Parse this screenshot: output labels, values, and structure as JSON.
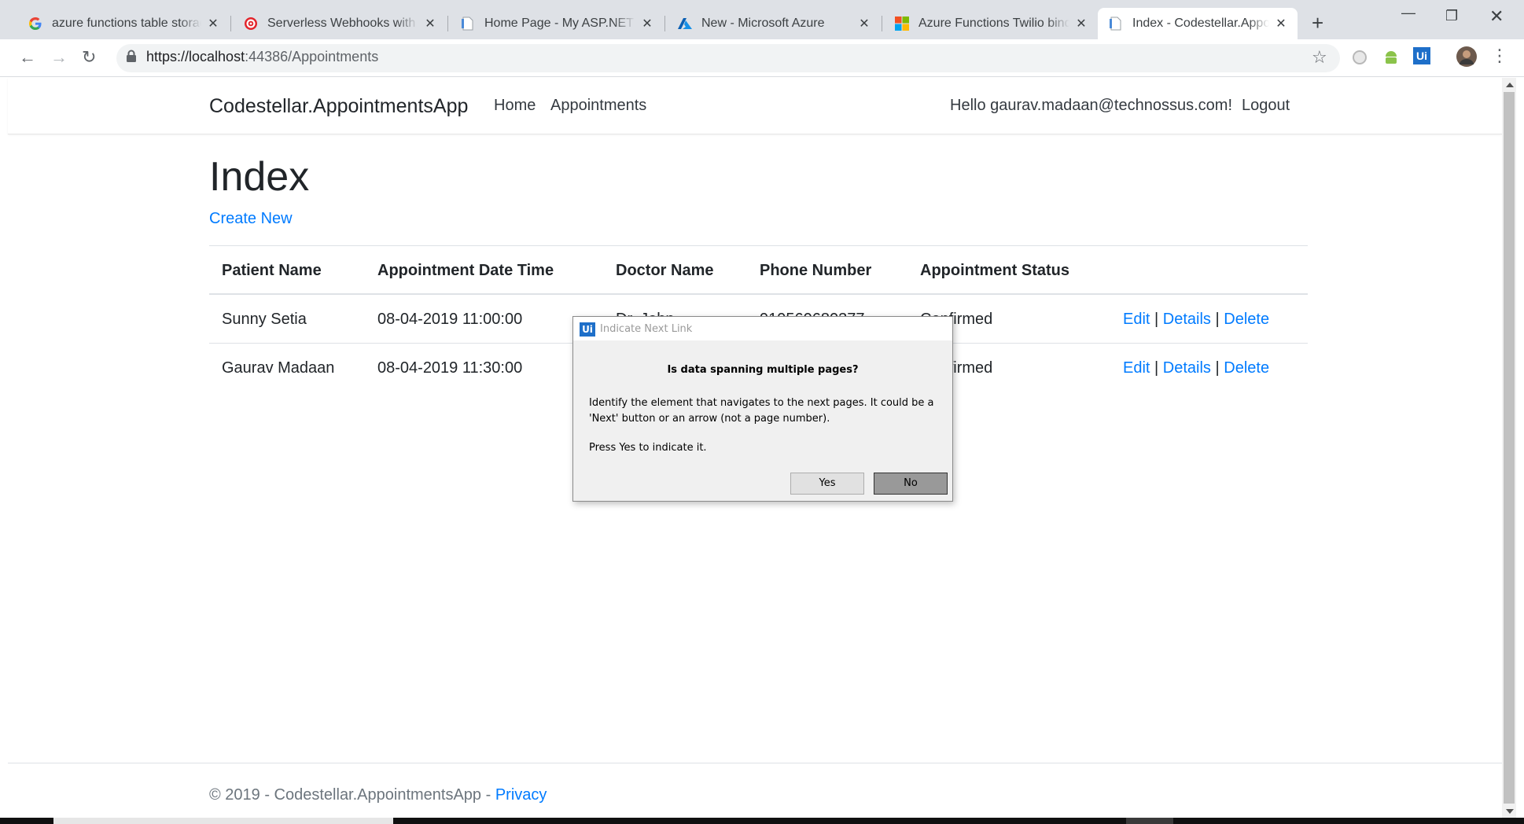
{
  "browser": {
    "tabs": [
      {
        "title": "azure functions table storage",
        "icon": "google-icon"
      },
      {
        "title": "Serverless Webhooks with Azure",
        "icon": "target-icon"
      },
      {
        "title": "Home Page - My ASP.NET App",
        "icon": "page-icon"
      },
      {
        "title": "New - Microsoft Azure",
        "icon": "azure-icon"
      },
      {
        "title": "Azure Functions Twilio binding",
        "icon": "microsoft-icon"
      },
      {
        "title": "Index - Codestellar.Appointments",
        "icon": "page-icon",
        "active": true
      }
    ],
    "address": {
      "scheme": "https://localhost",
      "port": ":44386",
      "path": "/Appointments"
    }
  },
  "navbar": {
    "brand": "Codestellar.AppointmentsApp",
    "links": [
      "Home",
      "Appointments"
    ],
    "greeting": "Hello gaurav.madaan@technossus.com!",
    "logout": "Logout"
  },
  "main": {
    "title": "Index",
    "create_new": "Create New",
    "table": {
      "columns": [
        "Patient Name",
        "Appointment Date Time",
        "Doctor Name",
        "Phone Number",
        "Appointment Status"
      ],
      "rows": [
        {
          "patient": "Sunny Setia",
          "datetime": "08-04-2019 11:00:00",
          "doctor": "Dr. John",
          "phone": "919560680377",
          "status": "Confirmed"
        },
        {
          "patient": "Gaurav Madaan",
          "datetime": "08-04-2019 11:30:00",
          "doctor": "",
          "phone": "",
          "status": "Confirmed"
        }
      ],
      "actions": {
        "edit": "Edit",
        "details": "Details",
        "delete": "Delete",
        "sep": "|"
      }
    }
  },
  "footer": {
    "text": "© 2019 - Codestellar.AppointmentsApp - ",
    "privacy": "Privacy"
  },
  "dialog": {
    "title": "Indicate Next Link",
    "logo": "Ui",
    "heading": "Is data spanning multiple pages?",
    "body": "Identify the element that navigates to the next pages. It could be a 'Next' button or an arrow (not a page number).",
    "press": "Press Yes to indicate it.",
    "yes": "Yes",
    "no": "No"
  },
  "colors": {
    "link": "#007bff",
    "text": "#212529",
    "chrome": "#dee1e6",
    "uipath": "#1e6fc9"
  }
}
